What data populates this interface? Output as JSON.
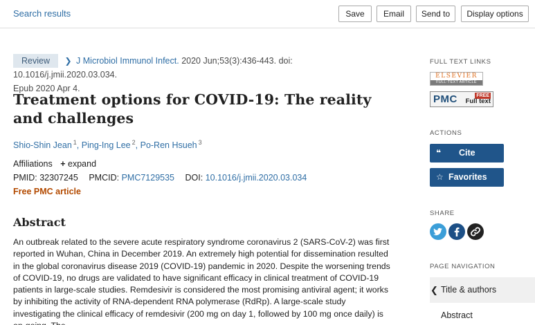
{
  "topbar": {
    "back_link": "Search results",
    "save": "Save",
    "email": "Email",
    "send_to": "Send to",
    "display_options": "Display options"
  },
  "article": {
    "type_badge": "Review",
    "journal": "J Microbiol Immunol Infect.",
    "citation": "2020 Jun;53(3):436-443. doi: 10.1016/j.jmii.2020.03.034.",
    "epub": "Epub 2020 Apr 4.",
    "title": "Treatment options for COVID-19: The reality and challenges",
    "authors": [
      {
        "name": "Shio-Shin Jean",
        "sup": "1"
      },
      {
        "name": "Ping-Ing Lee",
        "sup": "2"
      },
      {
        "name": "Po-Ren Hsueh",
        "sup": "3"
      }
    ],
    "affiliations_label": "Affiliations",
    "expand_label": "expand",
    "pmid_label": "PMID:",
    "pmid": "32307245",
    "pmcid_label": "PMCID:",
    "pmcid": "PMC7129535",
    "doi_label": "DOI:",
    "doi": "10.1016/j.jmii.2020.03.034",
    "free_pmc": "Free PMC article",
    "abstract_heading": "Abstract",
    "abstract_text": "An outbreak related to the severe acute respiratory syndrome coronavirus 2 (SARS-CoV-2) was first reported in Wuhan, China in December 2019. An extremely high potential for dissemination resulted in the global coronavirus disease 2019 (COVID-19) pandemic in 2020. Despite the worsening trends of COVID-19, no drugs are validated to have significant efficacy in clinical treatment of COVID-19 patients in large-scale studies. Remdesivir is considered the most promising antiviral agent; it works by inhibiting the activity of RNA-dependent RNA polymerase (RdRp). A large-scale study investigating the clinical efficacy of remdesivir (200 mg on day 1, followed by 100 mg once daily) is on-going. The"
  },
  "sidebar": {
    "full_text_links_label": "FULL TEXT LINKS",
    "elsevier_top": "ELSEVIER",
    "elsevier_bottom": "FULL-TEXT ARTICLE",
    "pmc_word": "PMC",
    "pmc_free": "FREE",
    "pmc_fulltext": "Full text",
    "actions_label": "ACTIONS",
    "cite": "Cite",
    "favorites": "Favorites",
    "share_label": "SHARE",
    "page_nav_label": "PAGE NAVIGATION",
    "nav_items": [
      "Title & authors",
      "Abstract"
    ]
  },
  "colors": {
    "link": "#2f6ea5",
    "action_button": "#20558a",
    "free_pmc": "#b34a00"
  }
}
